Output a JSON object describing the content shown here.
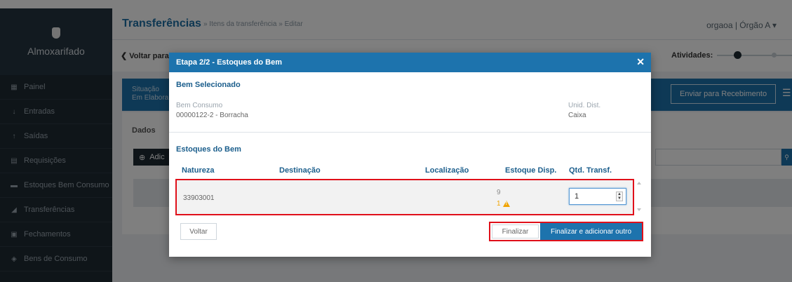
{
  "sidebar": {
    "brand": "Almoxarifado",
    "items": [
      {
        "label": "Painel",
        "icon": "dashboard-icon",
        "glyph": "▦"
      },
      {
        "label": "Entradas",
        "icon": "arrow-down-icon",
        "glyph": "↓"
      },
      {
        "label": "Saídas",
        "icon": "arrow-up-icon",
        "glyph": "↑"
      },
      {
        "label": "Requisições",
        "icon": "document-icon",
        "glyph": "▤"
      },
      {
        "label": "Estoques Bem Consumo",
        "icon": "warehouse-icon",
        "glyph": "▬"
      },
      {
        "label": "Transferências",
        "icon": "send-icon",
        "glyph": "◢"
      },
      {
        "label": "Fechamentos",
        "icon": "calendar-icon",
        "glyph": "▣"
      },
      {
        "label": "Bens de Consumo",
        "icon": "tag-icon",
        "glyph": "◈"
      }
    ]
  },
  "header": {
    "title": "Transferências",
    "breadcrumb": "» Itens da transferência » Editar",
    "user": "orgaoa | Órgão A ▾"
  },
  "subbar": {
    "back": "❮ Voltar para",
    "atividades": "Atividades:"
  },
  "status": {
    "label": "Situação",
    "value": "Em Elabora",
    "send_button": "Enviar para Recebimento"
  },
  "content": {
    "tab": "Dados",
    "add_button": "Adic"
  },
  "modal": {
    "title": "Etapa 2/2 - Estoques do Bem",
    "close": "✕",
    "selected_title": "Bem Selecionado",
    "bem_label": "Bem Consumo",
    "bem_value": "00000122-2 - Borracha",
    "unid_label": "Unid. Dist.",
    "unid_value": "Caixa",
    "stocks_title": "Estoques do Bem",
    "columns": {
      "natureza": "Natureza",
      "destinacao": "Destinação",
      "localizacao": "Localização",
      "estoque": "Estoque Disp.",
      "qtd": "Qtd. Transf."
    },
    "row": {
      "natureza": "33903001",
      "destinacao": "",
      "localizacao": "",
      "estoque": "9",
      "warning": "1",
      "qtd": "1"
    },
    "buttons": {
      "voltar": "Voltar",
      "finalizar": "Finalizar",
      "finalizar_outro": "Finalizar e adicionar outro"
    }
  },
  "colors": {
    "primary": "#1d73ad",
    "sidebar": "#1f2a33",
    "highlight": "#e0101a",
    "warning": "#f0a300"
  }
}
